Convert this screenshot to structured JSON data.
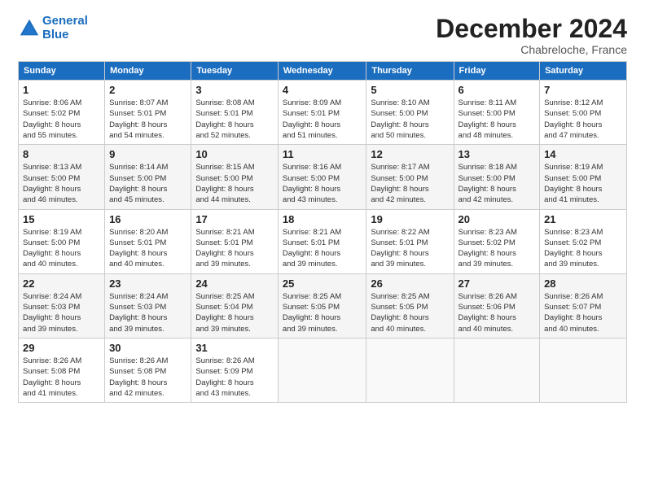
{
  "header": {
    "logo_line1": "General",
    "logo_line2": "Blue",
    "month_title": "December 2024",
    "location": "Chabreloche, France"
  },
  "days_of_week": [
    "Sunday",
    "Monday",
    "Tuesday",
    "Wednesday",
    "Thursday",
    "Friday",
    "Saturday"
  ],
  "weeks": [
    [
      {
        "day": "1",
        "info": "Sunrise: 8:06 AM\nSunset: 5:02 PM\nDaylight: 8 hours\nand 55 minutes."
      },
      {
        "day": "2",
        "info": "Sunrise: 8:07 AM\nSunset: 5:01 PM\nDaylight: 8 hours\nand 54 minutes."
      },
      {
        "day": "3",
        "info": "Sunrise: 8:08 AM\nSunset: 5:01 PM\nDaylight: 8 hours\nand 52 minutes."
      },
      {
        "day": "4",
        "info": "Sunrise: 8:09 AM\nSunset: 5:01 PM\nDaylight: 8 hours\nand 51 minutes."
      },
      {
        "day": "5",
        "info": "Sunrise: 8:10 AM\nSunset: 5:00 PM\nDaylight: 8 hours\nand 50 minutes."
      },
      {
        "day": "6",
        "info": "Sunrise: 8:11 AM\nSunset: 5:00 PM\nDaylight: 8 hours\nand 48 minutes."
      },
      {
        "day": "7",
        "info": "Sunrise: 8:12 AM\nSunset: 5:00 PM\nDaylight: 8 hours\nand 47 minutes."
      }
    ],
    [
      {
        "day": "8",
        "info": "Sunrise: 8:13 AM\nSunset: 5:00 PM\nDaylight: 8 hours\nand 46 minutes."
      },
      {
        "day": "9",
        "info": "Sunrise: 8:14 AM\nSunset: 5:00 PM\nDaylight: 8 hours\nand 45 minutes."
      },
      {
        "day": "10",
        "info": "Sunrise: 8:15 AM\nSunset: 5:00 PM\nDaylight: 8 hours\nand 44 minutes."
      },
      {
        "day": "11",
        "info": "Sunrise: 8:16 AM\nSunset: 5:00 PM\nDaylight: 8 hours\nand 43 minutes."
      },
      {
        "day": "12",
        "info": "Sunrise: 8:17 AM\nSunset: 5:00 PM\nDaylight: 8 hours\nand 42 minutes."
      },
      {
        "day": "13",
        "info": "Sunrise: 8:18 AM\nSunset: 5:00 PM\nDaylight: 8 hours\nand 42 minutes."
      },
      {
        "day": "14",
        "info": "Sunrise: 8:19 AM\nSunset: 5:00 PM\nDaylight: 8 hours\nand 41 minutes."
      }
    ],
    [
      {
        "day": "15",
        "info": "Sunrise: 8:19 AM\nSunset: 5:00 PM\nDaylight: 8 hours\nand 40 minutes."
      },
      {
        "day": "16",
        "info": "Sunrise: 8:20 AM\nSunset: 5:01 PM\nDaylight: 8 hours\nand 40 minutes."
      },
      {
        "day": "17",
        "info": "Sunrise: 8:21 AM\nSunset: 5:01 PM\nDaylight: 8 hours\nand 39 minutes."
      },
      {
        "day": "18",
        "info": "Sunrise: 8:21 AM\nSunset: 5:01 PM\nDaylight: 8 hours\nand 39 minutes."
      },
      {
        "day": "19",
        "info": "Sunrise: 8:22 AM\nSunset: 5:01 PM\nDaylight: 8 hours\nand 39 minutes."
      },
      {
        "day": "20",
        "info": "Sunrise: 8:23 AM\nSunset: 5:02 PM\nDaylight: 8 hours\nand 39 minutes."
      },
      {
        "day": "21",
        "info": "Sunrise: 8:23 AM\nSunset: 5:02 PM\nDaylight: 8 hours\nand 39 minutes."
      }
    ],
    [
      {
        "day": "22",
        "info": "Sunrise: 8:24 AM\nSunset: 5:03 PM\nDaylight: 8 hours\nand 39 minutes."
      },
      {
        "day": "23",
        "info": "Sunrise: 8:24 AM\nSunset: 5:03 PM\nDaylight: 8 hours\nand 39 minutes."
      },
      {
        "day": "24",
        "info": "Sunrise: 8:25 AM\nSunset: 5:04 PM\nDaylight: 8 hours\nand 39 minutes."
      },
      {
        "day": "25",
        "info": "Sunrise: 8:25 AM\nSunset: 5:05 PM\nDaylight: 8 hours\nand 39 minutes."
      },
      {
        "day": "26",
        "info": "Sunrise: 8:25 AM\nSunset: 5:05 PM\nDaylight: 8 hours\nand 40 minutes."
      },
      {
        "day": "27",
        "info": "Sunrise: 8:26 AM\nSunset: 5:06 PM\nDaylight: 8 hours\nand 40 minutes."
      },
      {
        "day": "28",
        "info": "Sunrise: 8:26 AM\nSunset: 5:07 PM\nDaylight: 8 hours\nand 40 minutes."
      }
    ],
    [
      {
        "day": "29",
        "info": "Sunrise: 8:26 AM\nSunset: 5:08 PM\nDaylight: 8 hours\nand 41 minutes."
      },
      {
        "day": "30",
        "info": "Sunrise: 8:26 AM\nSunset: 5:08 PM\nDaylight: 8 hours\nand 42 minutes."
      },
      {
        "day": "31",
        "info": "Sunrise: 8:26 AM\nSunset: 5:09 PM\nDaylight: 8 hours\nand 43 minutes."
      },
      {
        "day": "",
        "info": ""
      },
      {
        "day": "",
        "info": ""
      },
      {
        "day": "",
        "info": ""
      },
      {
        "day": "",
        "info": ""
      }
    ]
  ]
}
